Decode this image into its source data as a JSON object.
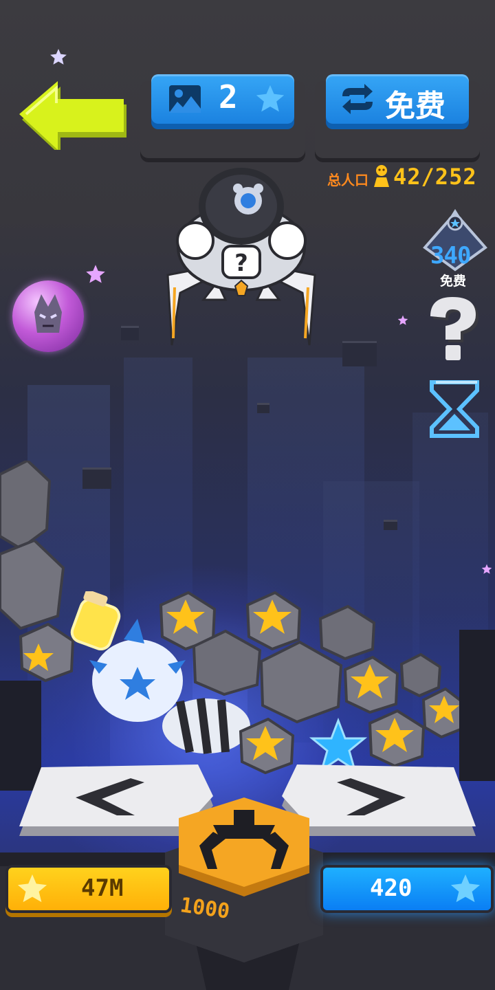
{
  "header": {
    "back_icon": "left-arrow-icon",
    "stage_button": {
      "icon": "landscape-icon",
      "value": "2",
      "star_icon": "star-icon"
    },
    "refresh_button": {
      "icon": "refresh-icon",
      "label": "免费"
    },
    "population": {
      "label": "总人口",
      "icon": "person-icon",
      "value": "42/252"
    }
  },
  "side_panel": {
    "badge": {
      "value": "340",
      "label": "免费",
      "icon": "rank-badge-icon"
    },
    "help_icon": "question-mark-icon",
    "timer_icon": "hourglass-icon",
    "avatar_icon": "purple-creature-orb-icon"
  },
  "bottom": {
    "left_button_icon": "chevron-left-icon",
    "right_button_icon": "chevron-right-icon",
    "claw_button_icon": "claw-icon",
    "claw_cost": "1000",
    "gold": {
      "icon": "star-icon",
      "value": "47M"
    },
    "stars": {
      "icon": "star-icon",
      "value": "420"
    }
  },
  "colors": {
    "accent_blue": "#1b82e0",
    "gold": "#ffc21a",
    "arrow_green": "#d8f21c",
    "claw_orange": "#f5a623"
  }
}
